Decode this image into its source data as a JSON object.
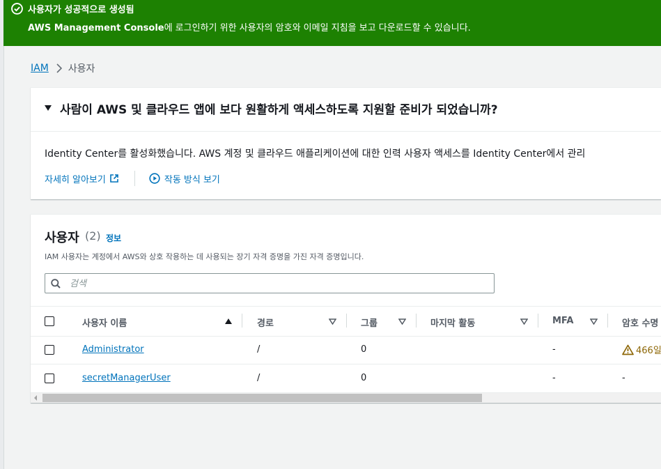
{
  "flash": {
    "title": "사용자가 성공적으로 생성됨",
    "message_strong": "AWS Management Console",
    "message_rest": "에 로그인하기 위한 사용자의 암호와 이메일 지침을 보고 다운로드할 수 있습니다.",
    "color": "#1d8102"
  },
  "breadcrumb": {
    "root": "IAM",
    "current": "사용자"
  },
  "promo": {
    "heading": "사람이 AWS 및 클라우드 앱에 보다 원활하게 액세스하도록 지원할 준비가 되었습니까?",
    "description": "Identity Center를 활성화했습니다. AWS 계정 및 클라우드 애플리케이션에 대한 인력 사용자 액세스를 Identity Center에서 관리",
    "learn_more": "자세히 알아보기",
    "how_it_works": "작동 방식 보기"
  },
  "users": {
    "title": "사용자",
    "count": "(2)",
    "info": "정보",
    "description": "IAM 사용자는 계정에서 AWS와 상호 작용하는 데 사용되는 장기 자격 증명을 가진 자격 증명입니다.",
    "search_placeholder": "검색",
    "columns": [
      "사용자 이름",
      "경로",
      "그룹",
      "마지막 활동",
      "MFA",
      "암호 수명"
    ],
    "rows": [
      {
        "name": "Administrator",
        "path": "/",
        "groups": "0",
        "last_activity": "",
        "mfa": "-",
        "password_age": "466일"
      },
      {
        "name": "secretManagerUser",
        "path": "/",
        "groups": "0",
        "last_activity": "",
        "mfa": "-",
        "password_age": "-"
      }
    ]
  },
  "icons": {
    "success": "check-circle-icon",
    "warning": "warning-icon",
    "external": "external-link-icon",
    "play": "play-circle-icon",
    "search": "search-icon"
  }
}
